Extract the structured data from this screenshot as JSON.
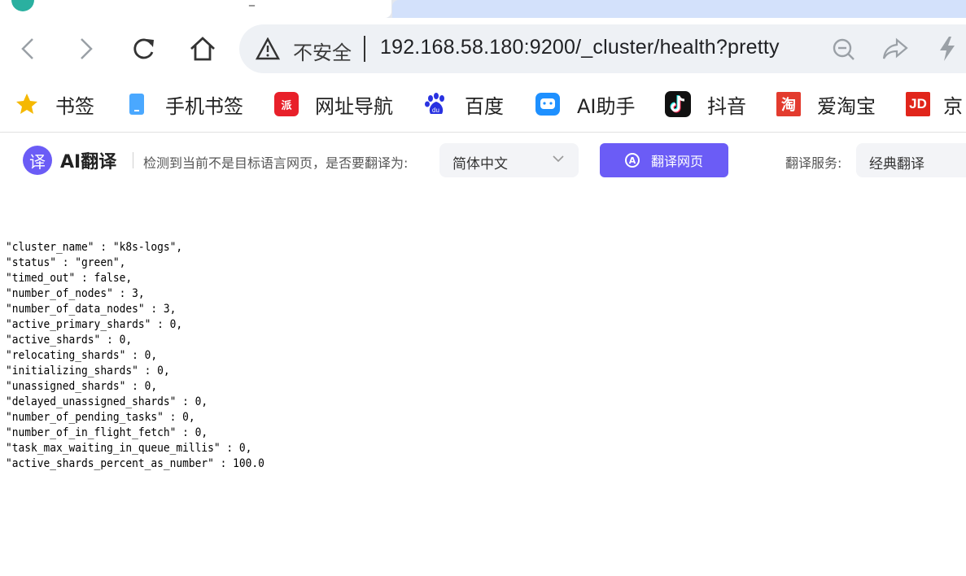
{
  "navbar": {
    "insecure_label": "不安全",
    "url": "192.168.58.180:9200/_cluster/health?pretty"
  },
  "bookmarks": [
    {
      "label": "书签",
      "icon": "star-icon",
      "color": "#f5b800"
    },
    {
      "label": "手机书签",
      "icon": "phone-bookmark-icon",
      "color": "#4aa8ff"
    },
    {
      "label": "网址导航",
      "icon": "nav-site-icon",
      "color": "#e8202a"
    },
    {
      "label": "百度",
      "icon": "baidu-icon",
      "color": "#2932e1"
    },
    {
      "label": "AI助手",
      "icon": "ai-assistant-icon",
      "color": "#1e90ff"
    },
    {
      "label": "抖音",
      "icon": "douyin-icon",
      "color": "#111111"
    },
    {
      "label": "爱淘宝",
      "icon": "taobao-icon",
      "color": "#e33b2e"
    },
    {
      "label": "京",
      "icon": "jd-icon",
      "color": "#e1251b"
    }
  ],
  "translate": {
    "logo_char": "译",
    "brand": "AI翻译",
    "prompt": "检测到当前不是目标语言网页，是否要翻译为:",
    "target_language": "简体中文",
    "translate_button": "翻译网页",
    "service_label": "翻译服务:",
    "service_value": "经典翻译",
    "accent": "#6b5cf6"
  },
  "json_lines": [
    "\"cluster_name\" : \"k8s-logs\",",
    "\"status\" : \"green\",",
    "\"timed_out\" : false,",
    "\"number_of_nodes\" : 3,",
    "\"number_of_data_nodes\" : 3,",
    "\"active_primary_shards\" : 0,",
    "\"active_shards\" : 0,",
    "\"relocating_shards\" : 0,",
    "\"initializing_shards\" : 0,",
    "\"unassigned_shards\" : 0,",
    "\"delayed_unassigned_shards\" : 0,",
    "\"number_of_pending_tasks\" : 0,",
    "\"number_of_in_flight_fetch\" : 0,",
    "\"task_max_waiting_in_queue_millis\" : 0,",
    "\"active_shards_percent_as_number\" : 100.0"
  ]
}
